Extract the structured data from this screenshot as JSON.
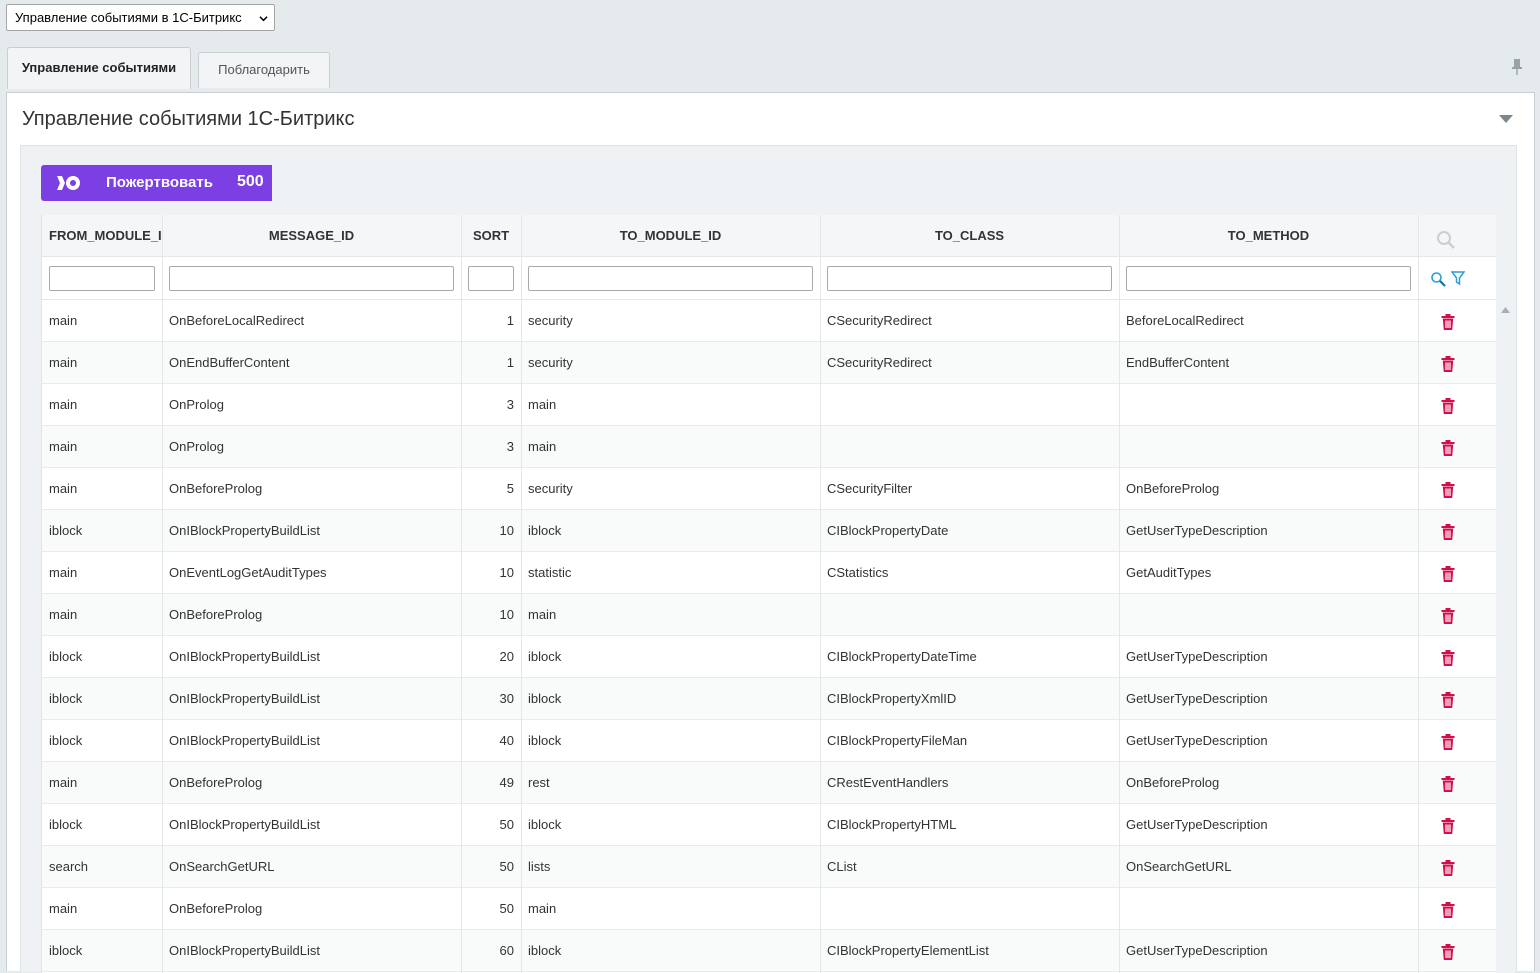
{
  "module_select": {
    "value": "Управление событиями в 1С-Битрикс"
  },
  "tabs": [
    {
      "label": "Управление событиями"
    },
    {
      "label": "Поблагодарить"
    }
  ],
  "panel": {
    "title": "Управление событиями 1С-Битрикс"
  },
  "donate": {
    "label": "Пожертвовать",
    "amount": "500",
    "color": "#7b3fe4"
  },
  "table": {
    "columns": [
      "FROM_MODULE_ID",
      "MESSAGE_ID",
      "SORT",
      "TO_MODULE_ID",
      "TO_CLASS",
      "TO_METHOD"
    ],
    "rows": [
      [
        "main",
        "OnBeforeLocalRedirect",
        "1",
        "security",
        "CSecurityRedirect",
        "BeforeLocalRedirect"
      ],
      [
        "main",
        "OnEndBufferContent",
        "1",
        "security",
        "CSecurityRedirect",
        "EndBufferContent"
      ],
      [
        "main",
        "OnProlog",
        "3",
        "main",
        "",
        ""
      ],
      [
        "main",
        "OnProlog",
        "3",
        "main",
        "",
        ""
      ],
      [
        "main",
        "OnBeforeProlog",
        "5",
        "security",
        "CSecurityFilter",
        "OnBeforeProlog"
      ],
      [
        "iblock",
        "OnIBlockPropertyBuildList",
        "10",
        "iblock",
        "CIBlockPropertyDate",
        "GetUserTypeDescription"
      ],
      [
        "main",
        "OnEventLogGetAuditTypes",
        "10",
        "statistic",
        "CStatistics",
        "GetAuditTypes"
      ],
      [
        "main",
        "OnBeforeProlog",
        "10",
        "main",
        "",
        ""
      ],
      [
        "iblock",
        "OnIBlockPropertyBuildList",
        "20",
        "iblock",
        "CIBlockPropertyDateTime",
        "GetUserTypeDescription"
      ],
      [
        "iblock",
        "OnIBlockPropertyBuildList",
        "30",
        "iblock",
        "CIBlockPropertyXmlID",
        "GetUserTypeDescription"
      ],
      [
        "iblock",
        "OnIBlockPropertyBuildList",
        "40",
        "iblock",
        "CIBlockPropertyFileMan",
        "GetUserTypeDescription"
      ],
      [
        "main",
        "OnBeforeProlog",
        "49",
        "rest",
        "CRestEventHandlers",
        "OnBeforeProlog"
      ],
      [
        "iblock",
        "OnIBlockPropertyBuildList",
        "50",
        "iblock",
        "CIBlockPropertyHTML",
        "GetUserTypeDescription"
      ],
      [
        "search",
        "OnSearchGetURL",
        "50",
        "lists",
        "CList",
        "OnSearchGetURL"
      ],
      [
        "main",
        "OnBeforeProlog",
        "50",
        "main",
        "",
        ""
      ],
      [
        "iblock",
        "OnIBlockPropertyBuildList",
        "60",
        "iblock",
        "CIBlockPropertyElementList",
        "GetUserTypeDescription"
      ]
    ]
  },
  "icons": {
    "delete": "trash-icon",
    "search": "search-icon",
    "filter": "funnel-icon",
    "pin": "pin-icon",
    "collapse": "triangle-down-icon"
  },
  "colors": {
    "delete": "#d0104c",
    "accent": "#2a9fd6"
  }
}
